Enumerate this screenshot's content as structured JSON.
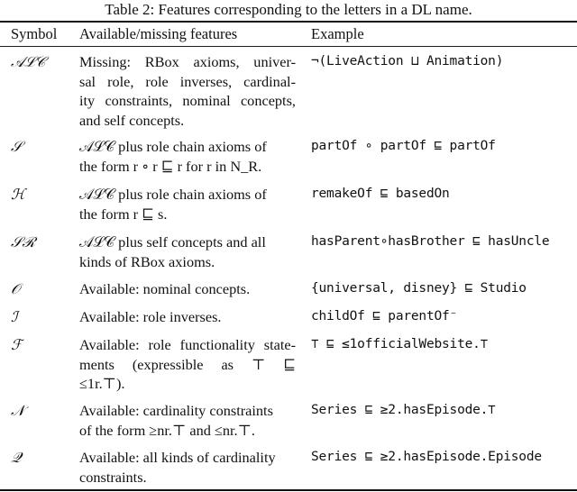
{
  "caption": "Table 2: Features corresponding to the letters in a DL name.",
  "headers": {
    "symbol": "Symbol",
    "features": "Available/missing features",
    "example": "Example"
  },
  "rows": [
    {
      "symbol": "𝒜ℒ𝒞",
      "features_lines": [
        "Missing: RBox axioms, univer-",
        "sal role, role inverses, cardinal-",
        "ity constraints, nominal concepts,",
        "and self concepts."
      ],
      "example": "¬(LiveAction ⊔ Animation)"
    },
    {
      "symbol": "𝒮",
      "features_lines": [
        "𝒜ℒ𝒞 plus role chain axioms of",
        "the form r ∘ r ⊑ r for r in N_R."
      ],
      "example": "partOf ∘ partOf ⊑ partOf"
    },
    {
      "symbol": "ℋ",
      "features_lines": [
        "𝒜ℒ𝒞 plus role chain axioms of",
        "the form r ⊑ s."
      ],
      "example": "remakeOf ⊑ basedOn"
    },
    {
      "symbol": "𝒮ℛ",
      "features_lines": [
        "𝒜ℒ𝒞 plus self concepts and all",
        "kinds of RBox axioms."
      ],
      "example": "hasParent∘hasBrother ⊑ hasUncle"
    },
    {
      "symbol": "𝒪",
      "features_lines": [
        "Available: nominal concepts."
      ],
      "example": "{universal, disney} ⊑ Studio"
    },
    {
      "symbol": "ℐ",
      "features_lines": [
        "Available: role inverses."
      ],
      "example": "childOf ⊑ parentOf⁻"
    },
    {
      "symbol": "ℱ",
      "features_lines": [
        "Available: role functionality state-",
        "ments (expressible as ⊤ ⊑",
        "≤1r.⊤)."
      ],
      "example": "⊤ ⊑ ≤1officialWebsite.⊤"
    },
    {
      "symbol": "𝒩",
      "features_lines": [
        "Available: cardinality constraints",
        "of the form ≥nr.⊤ and ≤nr.⊤."
      ],
      "example": "Series ⊑ ≥2.hasEpisode.⊤"
    },
    {
      "symbol": "𝒬",
      "features_lines": [
        "Available: all kinds of cardinality",
        "constraints."
      ],
      "example": "Series ⊑ ≥2.hasEpisode.Episode"
    }
  ]
}
